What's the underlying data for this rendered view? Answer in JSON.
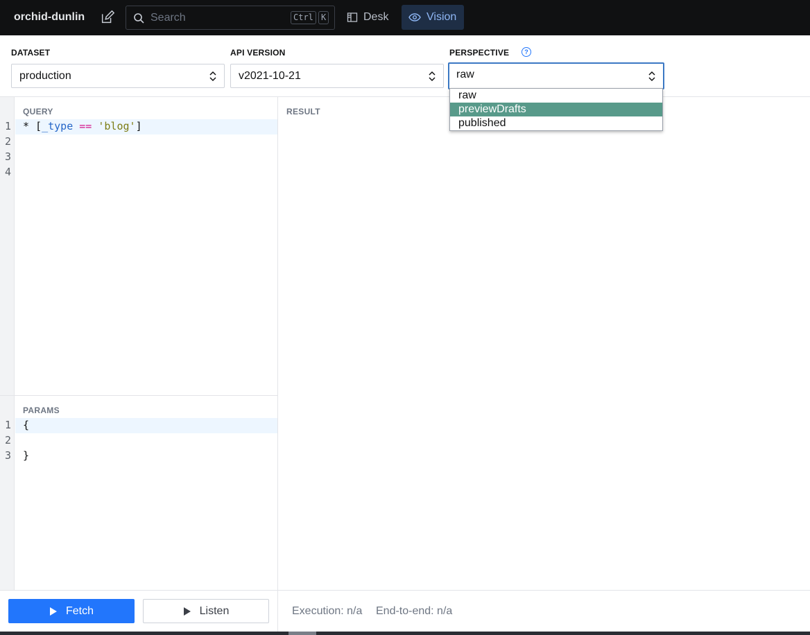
{
  "app": {
    "project": "orchid-dunlin",
    "search_placeholder": "Search",
    "shortcut_ctrl": "Ctrl",
    "shortcut_key": "K",
    "tools": [
      {
        "label": "Desk",
        "icon": "desk-icon",
        "active": false
      },
      {
        "label": "Vision",
        "icon": "eye-icon",
        "active": true
      }
    ]
  },
  "controls": {
    "dataset_label": "DATASET",
    "dataset_value": "production",
    "api_label": "API VERSION",
    "api_value": "v2021-10-21",
    "perspective_label": "PERSPECTIVE",
    "perspective_help": "?",
    "perspective_value": "raw",
    "perspective_options": [
      "raw",
      "previewDrafts",
      "published"
    ],
    "perspective_highlighted": "previewDrafts"
  },
  "query": {
    "title": "QUERY",
    "line_numbers": [
      "1",
      "2",
      "3",
      "4"
    ],
    "tokens": {
      "star": "* [",
      "field": "_type",
      "op": "==",
      "str": "'blog'",
      "close": "]"
    }
  },
  "params": {
    "title": "PARAMS",
    "line_numbers": [
      "1",
      "2",
      "3"
    ],
    "lines": [
      "{",
      "",
      "}"
    ]
  },
  "result": {
    "title": "RESULT"
  },
  "footer": {
    "fetch_label": "Fetch",
    "listen_label": "Listen",
    "execution": "Execution: n/a",
    "end_to_end": "End-to-end: n/a"
  },
  "colors": {
    "accent": "#2276fc",
    "nav_bg": "#101112",
    "highlight_option": "#589a8a"
  }
}
